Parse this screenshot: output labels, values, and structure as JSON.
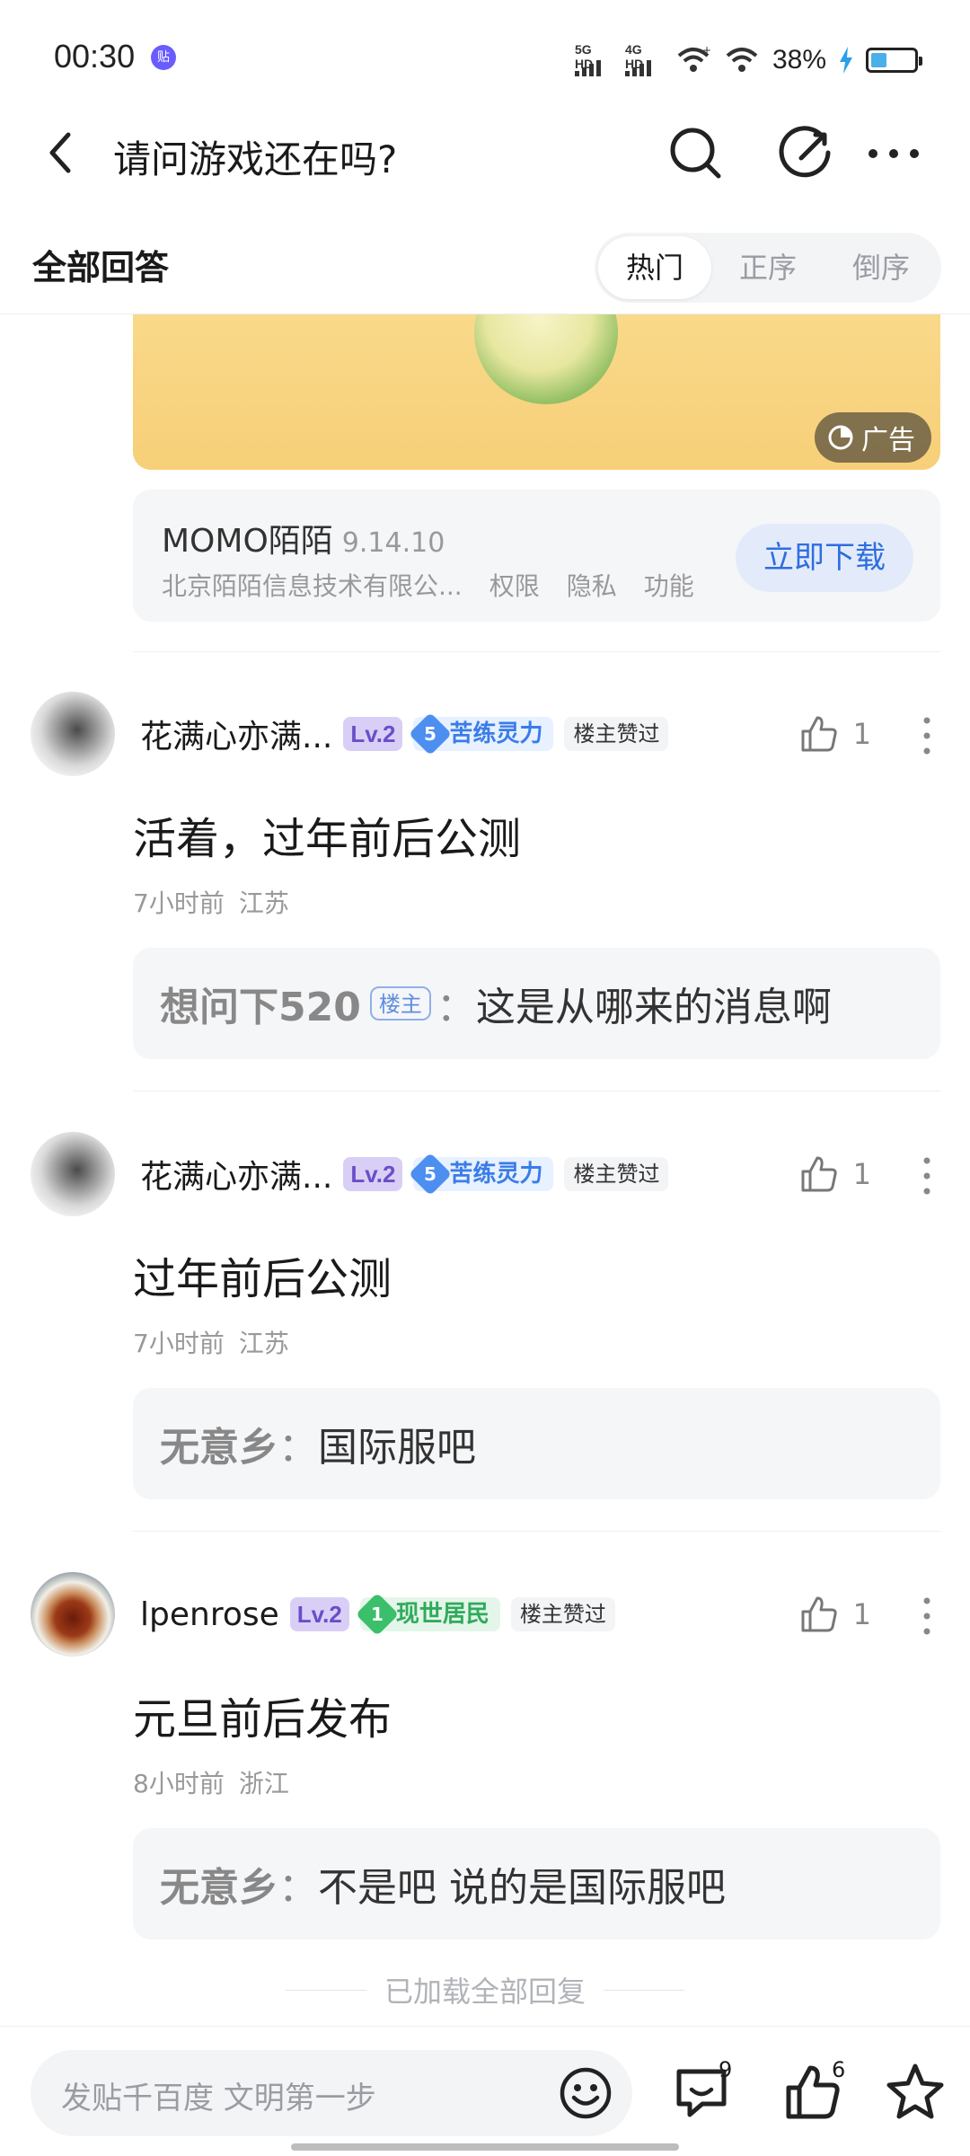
{
  "status_bar": {
    "time": "00:30",
    "app_badge": "贴",
    "signal_1": "5G HD",
    "signal_2": "4G HD",
    "battery": "38%",
    "battery_level": 0.38
  },
  "header": {
    "title": "请问游戏还在吗?"
  },
  "sort": {
    "title": "全部回答",
    "tabs": [
      "热门",
      "正序",
      "倒序"
    ],
    "active": "热门"
  },
  "ad": {
    "badge": "广告",
    "app_name": "MOMO陌陌",
    "app_version": "9.14.10",
    "developer": "北京陌陌信息技术有限公...",
    "links": [
      "权限",
      "隐私",
      "功能"
    ],
    "download": "立即下载"
  },
  "posts": [
    {
      "username": "花满心亦满...",
      "level": "Lv.2",
      "rank_num": "5",
      "rank_name": "苦练灵力",
      "liked_badge": "楼主赞过",
      "likes": "1",
      "text": "活着，过年前后公测",
      "time": "7小时前",
      "location": "江苏",
      "reply": {
        "name": "想问下520",
        "op_tag": "楼主",
        "colon": "：",
        "text": "这是从哪来的消息啊"
      }
    },
    {
      "username": "花满心亦满...",
      "level": "Lv.2",
      "rank_num": "5",
      "rank_name": "苦练灵力",
      "liked_badge": "楼主赞过",
      "likes": "1",
      "text": "过年前后公测",
      "time": "7小时前",
      "location": "江苏",
      "reply": {
        "name": "无意乡",
        "colon": "：",
        "text": "国际服吧"
      }
    },
    {
      "username": "lpenrose",
      "level": "Lv.2",
      "rank_num": "1",
      "rank_name": "现世居民",
      "liked_badge": "楼主赞过",
      "likes": "1",
      "text": "元旦前后发布",
      "time": "8小时前",
      "location": "浙江",
      "reply": {
        "name": "无意乡",
        "colon": "：",
        "text": "不是吧 说的是国际服吧"
      }
    }
  ],
  "footer_note": "已加载全部回复",
  "bottom_bar": {
    "placeholder": "发贴千百度 文明第一步",
    "comment_count": "9",
    "like_count": "6"
  },
  "colors": {
    "accent": "#2f6ee0",
    "level_badge": "#6a4ec9",
    "rank_blue": "#3a7ce8",
    "rank_green": "#2fab5b"
  }
}
